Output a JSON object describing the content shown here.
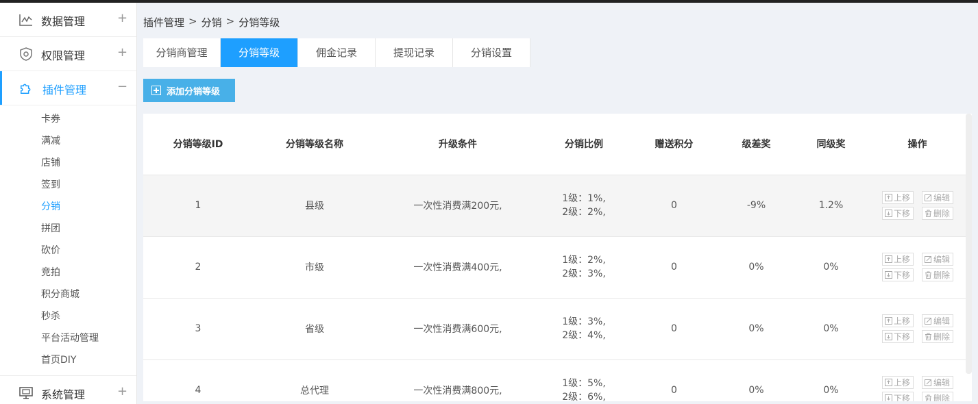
{
  "sidebar": {
    "groups": [
      {
        "label": "数据管理",
        "icon": "chart-line-icon",
        "toggle": "+"
      },
      {
        "label": "权限管理",
        "icon": "shield-icon",
        "toggle": "+"
      },
      {
        "label": "插件管理",
        "icon": "puzzle-icon",
        "toggle": "−"
      }
    ],
    "subitems": [
      "卡券",
      "满减",
      "店铺",
      "签到",
      "分销",
      "拼团",
      "砍价",
      "竞拍",
      "积分商城",
      "秒杀",
      "平台活动管理",
      "首页DIY"
    ],
    "active_subitem": "分销",
    "system": {
      "label": "系统管理",
      "icon": "monitor-icon",
      "toggle": "+"
    }
  },
  "breadcrumb": [
    "插件管理",
    "分销",
    "分销等级"
  ],
  "breadcrumb_sep": ">",
  "tabs": [
    "分销商管理",
    "分销等级",
    "佣金记录",
    "提现记录",
    "分销设置"
  ],
  "active_tab": "分销等级",
  "add_button": "添加分销等级",
  "table": {
    "headers": [
      "分销等级ID",
      "分销等级名称",
      "升级条件",
      "分销比例",
      "赠送积分",
      "级差奖",
      "同级奖",
      "操作"
    ],
    "rows": [
      {
        "id": "1",
        "name": "县级",
        "condition": "一次性消费满200元,",
        "ratio1": "1级：1%,",
        "ratio2": "2级：2%,",
        "points": "0",
        "diff": "-9%",
        "same": "1.2%"
      },
      {
        "id": "2",
        "name": "市级",
        "condition": "一次性消费满400元,",
        "ratio1": "1级：2%,",
        "ratio2": "2级：3%,",
        "points": "0",
        "diff": "0%",
        "same": "0%"
      },
      {
        "id": "3",
        "name": "省级",
        "condition": "一次性消费满600元,",
        "ratio1": "1级：3%,",
        "ratio2": "2级：4%,",
        "points": "0",
        "diff": "0%",
        "same": "0%"
      },
      {
        "id": "4",
        "name": "总代理",
        "condition": "一次性消费满800元,",
        "ratio1": "1级：5%,",
        "ratio2": "2级：6%,",
        "points": "0",
        "diff": "0%",
        "same": "0%"
      }
    ],
    "ops": {
      "up": "上移",
      "edit": "编辑",
      "down": "下移",
      "delete": "删除"
    }
  },
  "colors": {
    "accent": "#1e9fff",
    "add_button": "#48b0e8",
    "row_highlight": "#f5f5f5"
  }
}
